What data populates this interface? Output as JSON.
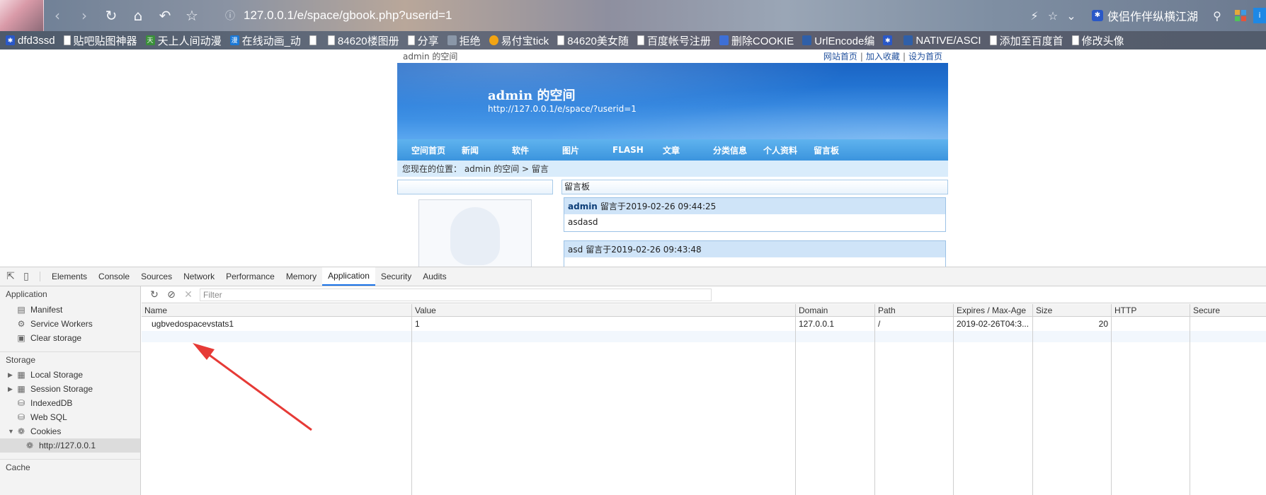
{
  "browser": {
    "url": "127.0.0.1/e/space/gbook.php?userid=1",
    "search_engine_label": "侠侣作伴纵横江湖",
    "nav_icons": [
      "back-icon",
      "forward-icon",
      "reload-icon",
      "home-icon",
      "undo-icon",
      "star-icon"
    ],
    "bookmarks": [
      {
        "label": "dfd3ssd",
        "icon": "paw"
      },
      {
        "label": "贴吧贴图神器",
        "icon": "page"
      },
      {
        "label": "天上人间动漫",
        "icon": "sky"
      },
      {
        "label": "在线动画_动",
        "icon": "man"
      },
      {
        "label": "",
        "icon": "page"
      },
      {
        "label": "84620楼图册",
        "icon": "page"
      },
      {
        "label": "分享",
        "icon": "page"
      },
      {
        "label": "拒绝",
        "icon": "img"
      },
      {
        "label": "易付宝tick",
        "icon": "coin"
      },
      {
        "label": "84620美女随",
        "icon": "page"
      },
      {
        "label": "百度帐号注册",
        "icon": "page"
      },
      {
        "label": "删除COOKIE",
        "icon": "shield"
      },
      {
        "label": "UrlEncode编",
        "icon": "url"
      },
      {
        "label": "",
        "icon": "paw"
      },
      {
        "label": "NATIVE/ASCI",
        "icon": "url"
      },
      {
        "label": "添加至百度首",
        "icon": "page"
      },
      {
        "label": "修改头像",
        "icon": "page"
      }
    ]
  },
  "site": {
    "toolbar_left": "admin 的空间",
    "links": [
      "网站首页",
      "加入收藏",
      "设为首页"
    ],
    "banner_title": "admin 的空间",
    "banner_url": "http://127.0.0.1/e/space/?userid=1",
    "nav": [
      "空间首页",
      "新闻",
      "软件",
      "图片",
      "FLASH",
      "文章",
      "分类信息",
      "个人资料",
      "留言板"
    ],
    "breadcrumb": "您现在的位置： admin 的空间 > 留言",
    "board_title": "留言板",
    "messages": [
      {
        "author": "admin",
        "meta": "留言于2019-02-26 09:44:25",
        "body": "asdasd"
      },
      {
        "author": "asd",
        "meta": "留言于2019-02-26 09:43:48",
        "body": ""
      }
    ]
  },
  "devtools": {
    "tabs": [
      "Elements",
      "Console",
      "Sources",
      "Network",
      "Performance",
      "Memory",
      "Application",
      "Security",
      "Audits"
    ],
    "active_tab": "Application",
    "sidebar": {
      "application_title": "Application",
      "application_items": [
        "Manifest",
        "Service Workers",
        "Clear storage"
      ],
      "storage_title": "Storage",
      "storage_items": [
        "Local Storage",
        "Session Storage",
        "IndexedDB",
        "Web SQL",
        "Cookies"
      ],
      "cookie_origin": "http://127.0.0.1",
      "cache_title": "Cache"
    },
    "filter_placeholder": "Filter",
    "columns": [
      "Name",
      "Value",
      "Domain",
      "Path",
      "Expires / Max-Age",
      "Size",
      "HTTP",
      "Secure"
    ],
    "rows": [
      {
        "name": "ugbvedospacevstats1",
        "value": "1",
        "domain": "127.0.0.1",
        "path": "/",
        "expires": "2019-02-26T04:3...",
        "size": "20",
        "http": "",
        "secure": ""
      }
    ]
  },
  "colors": {
    "annotation_arrow": "#e63a36",
    "active_tab_underline": "#1a73e8",
    "banner_blue": "#1a64c4"
  }
}
